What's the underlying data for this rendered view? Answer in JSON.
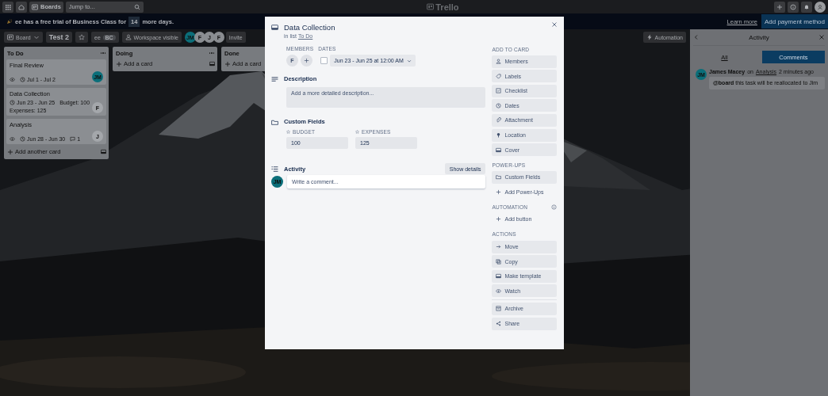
{
  "header": {
    "boards": "Boards",
    "search": {
      "placeholder": "Jump to..."
    },
    "logo": "Trello"
  },
  "banner": {
    "text": "ee has a free trial of Business Class for",
    "days": "14",
    "after": "more days.",
    "link": "Learn more",
    "button": "Add payment method"
  },
  "board_bar": {
    "view": "Board",
    "name": "Test 2",
    "workspace": "ee",
    "plan": "BC",
    "visibility": "Workspace visible",
    "invite": "Invite",
    "automation": "Automation",
    "members": [
      {
        "initials": "JM",
        "color": "#0b6e79"
      },
      {
        "initials": "F",
        "color": "#8a8d91"
      },
      {
        "initials": "J",
        "color": "#8a8d91"
      },
      {
        "initials": "F",
        "color": "#8a8d91"
      }
    ]
  },
  "lists": [
    {
      "title": "To Do",
      "add": "Add another card",
      "cards": [
        {
          "title": "Final Review",
          "badges": [
            {
              "kind": "watch"
            },
            {
              "kind": "date",
              "text": "Jul 1 - Jul 2"
            }
          ],
          "member": {
            "initials": "JM",
            "color": "#0b6e79"
          }
        },
        {
          "title": "Data Collection",
          "badges": [
            {
              "kind": "date",
              "text": "Jun 23 - Jun 25"
            },
            {
              "kind": "text",
              "text": "Budget: 100"
            },
            {
              "kind": "text",
              "text": "Expenses: 125"
            }
          ],
          "member": {
            "initials": "F",
            "color": "#a4a7ab"
          }
        },
        {
          "title": "Analysis",
          "badges": [
            {
              "kind": "watch"
            },
            {
              "kind": "date",
              "text": "Jun 28 - Jun 30"
            },
            {
              "kind": "comments",
              "text": "1"
            }
          ],
          "member": {
            "initials": "J",
            "color": "#a4a7ab"
          }
        }
      ]
    },
    {
      "title": "Doing",
      "add": "Add a card"
    },
    {
      "title": "Done",
      "add": "Add a card"
    }
  ],
  "modal": {
    "title": "Data Collection",
    "list_prefix": "in list",
    "list_link": "To Do",
    "members_label": "MEMBERS",
    "members": [
      "F"
    ],
    "dates_label": "DATES",
    "date_done": false,
    "date": "Jun 23 - Jun 25 at 12:00 AM",
    "description_heading": "Description",
    "description_placeholder": "Add a more detailed description...",
    "custom_fields_heading": "Custom Fields",
    "fields": [
      {
        "label": "BUDGET",
        "value": "100"
      },
      {
        "label": "EXPENSES",
        "value": "125"
      }
    ],
    "activity_heading": "Activity",
    "show_details": "Show details",
    "comment_avatar": "JM",
    "comment_placeholder": "Write a comment...",
    "sections": [
      {
        "title": "ADD TO CARD",
        "items": [
          {
            "kind": "person",
            "label": "Members"
          },
          {
            "kind": "tag",
            "label": "Labels"
          },
          {
            "kind": "checklist",
            "label": "Checklist"
          },
          {
            "kind": "clock",
            "label": "Dates"
          },
          {
            "kind": "clip",
            "label": "Attachment"
          },
          {
            "kind": "pin",
            "label": "Location"
          },
          {
            "kind": "card",
            "label": "Cover"
          }
        ]
      },
      {
        "title": "POWER-UPS",
        "items": [
          {
            "kind": "fields",
            "label": "Custom Fields"
          },
          {
            "kind": "plus",
            "label": "Add Power-Ups"
          }
        ]
      },
      {
        "title": "AUTOMATION",
        "info": true,
        "items": [
          {
            "kind": "plus",
            "label": "Add button"
          }
        ]
      },
      {
        "title": "ACTIONS",
        "items": [
          {
            "kind": "arrow",
            "label": "Move"
          },
          {
            "kind": "copy",
            "label": "Copy"
          },
          {
            "kind": "card",
            "label": "Make template"
          },
          {
            "kind": "eye",
            "label": "Watch"
          },
          {
            "kind": "archive",
            "label": "Archive",
            "divider": true
          },
          {
            "kind": "share",
            "label": "Share"
          }
        ]
      }
    ]
  },
  "activity_panel": {
    "title": "Activity",
    "tabs": [
      {
        "label": "All",
        "selected": false
      },
      {
        "label": "Comments",
        "selected": true
      }
    ],
    "comments": [
      {
        "avatar": "JM",
        "author": "James Macey",
        "on": "on",
        "card": "Analysis",
        "time": "2 minutes ago",
        "text": "**@board** this task will be reallocated to Jim"
      }
    ]
  }
}
